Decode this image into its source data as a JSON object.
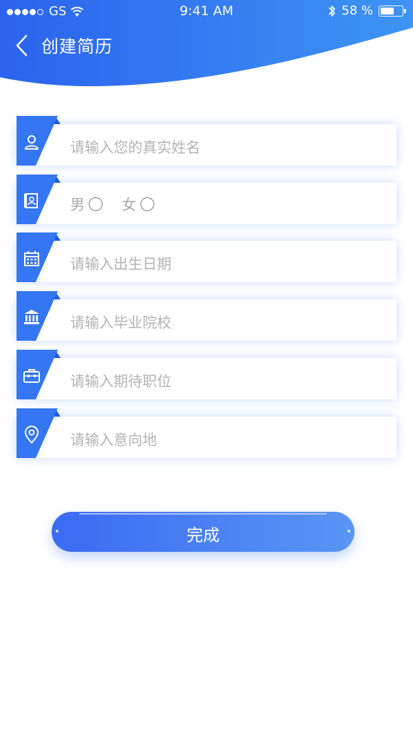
{
  "colors": {
    "accent": "#2f6ff0",
    "accent_light": "#3f8ff5",
    "placeholder": "#b3b3b3"
  },
  "status_bar": {
    "carrier": "GS",
    "time": "9:41 AM",
    "battery": "58 %"
  },
  "nav": {
    "title": "创建简历",
    "back_icon": "chevron-left-icon"
  },
  "form": {
    "name": {
      "placeholder": "请输入您的真实姓名",
      "icon": "user-icon"
    },
    "gender": {
      "male": "男",
      "female": "女",
      "icon": "id-card-icon"
    },
    "birth": {
      "placeholder": "请输入出生日期",
      "icon": "calendar-icon"
    },
    "school": {
      "placeholder": "请输入毕业院校",
      "icon": "institution-icon"
    },
    "job": {
      "placeholder": "请输入期待职位",
      "icon": "briefcase-icon"
    },
    "location": {
      "placeholder": "请输入意向地",
      "icon": "location-pin-icon"
    }
  },
  "submit": {
    "label": "完成"
  }
}
